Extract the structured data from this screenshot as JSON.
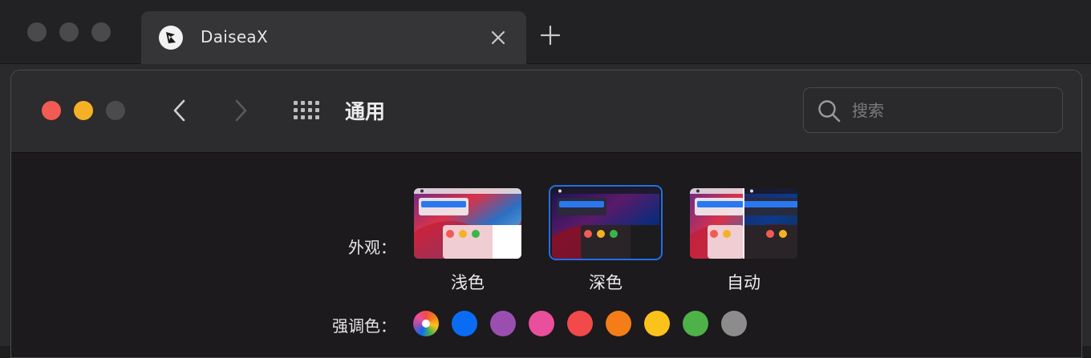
{
  "browser": {
    "tab_title": "DaiseaX",
    "new_tab_symbol": "+",
    "close_symbol": "×"
  },
  "window": {
    "title": "通用",
    "search_placeholder": "搜索"
  },
  "appearance": {
    "label": "外观：",
    "options": [
      {
        "label": "浅色",
        "selected": false
      },
      {
        "label": "深色",
        "selected": true
      },
      {
        "label": "自动",
        "selected": false
      }
    ]
  },
  "accent": {
    "label": "强调色：",
    "colors": [
      "multicolor",
      "#0a6cf5",
      "#9a4fb0",
      "#ea4f9c",
      "#f24a4a",
      "#f47d17",
      "#fbc21b",
      "#4eb248",
      "#8c8c8c"
    ]
  },
  "icons": {
    "back": "chevron-left-icon",
    "forward": "chevron-right-icon",
    "grid": "grid-icon",
    "search": "search-icon"
  }
}
